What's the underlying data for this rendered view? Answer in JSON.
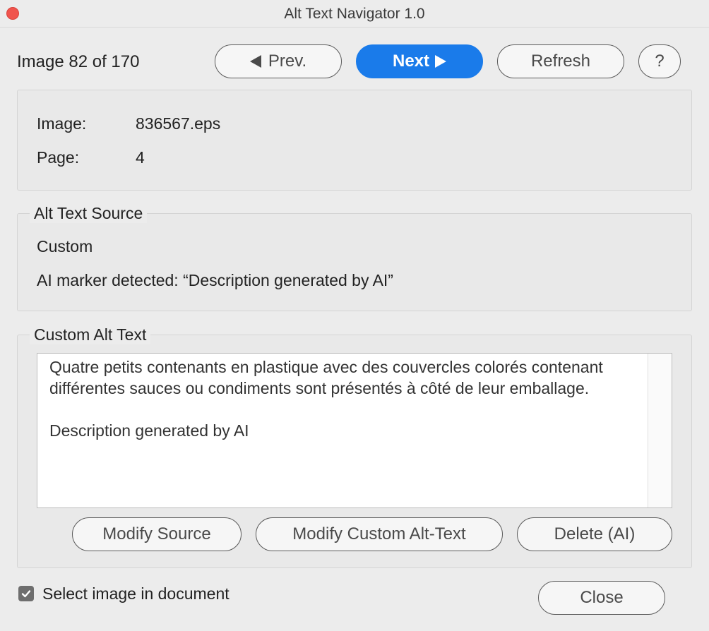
{
  "window": {
    "title": "Alt Text Navigator 1.0"
  },
  "nav": {
    "counter": "Image 82 of 170",
    "prev_label": "Prev.",
    "next_label": "Next",
    "refresh_label": "Refresh",
    "help_label": "?"
  },
  "image_info": {
    "image_label": "Image:",
    "image_value": "836567.eps",
    "page_label": "Page:",
    "page_value": "4"
  },
  "alt_text_source": {
    "legend": "Alt Text Source",
    "source_value": "Custom",
    "marker_text": "AI marker detected: “Description generated by AI”"
  },
  "custom_alt_text": {
    "legend": "Custom Alt Text",
    "text": "Quatre petits contenants en plastique avec des couvercles colorés contenant différentes sauces ou condiments sont présentés à côté de leur emballage.\n\nDescription generated by AI",
    "modify_source_label": "Modify Source",
    "modify_custom_label": "Modify Custom Alt-Text",
    "delete_ai_label": "Delete (AI)"
  },
  "footer": {
    "select_image_label": "Select image in document",
    "select_image_checked": true,
    "close_label": "Close"
  },
  "colors": {
    "accent": "#1a7bea",
    "close_dot": "#f0544d"
  }
}
